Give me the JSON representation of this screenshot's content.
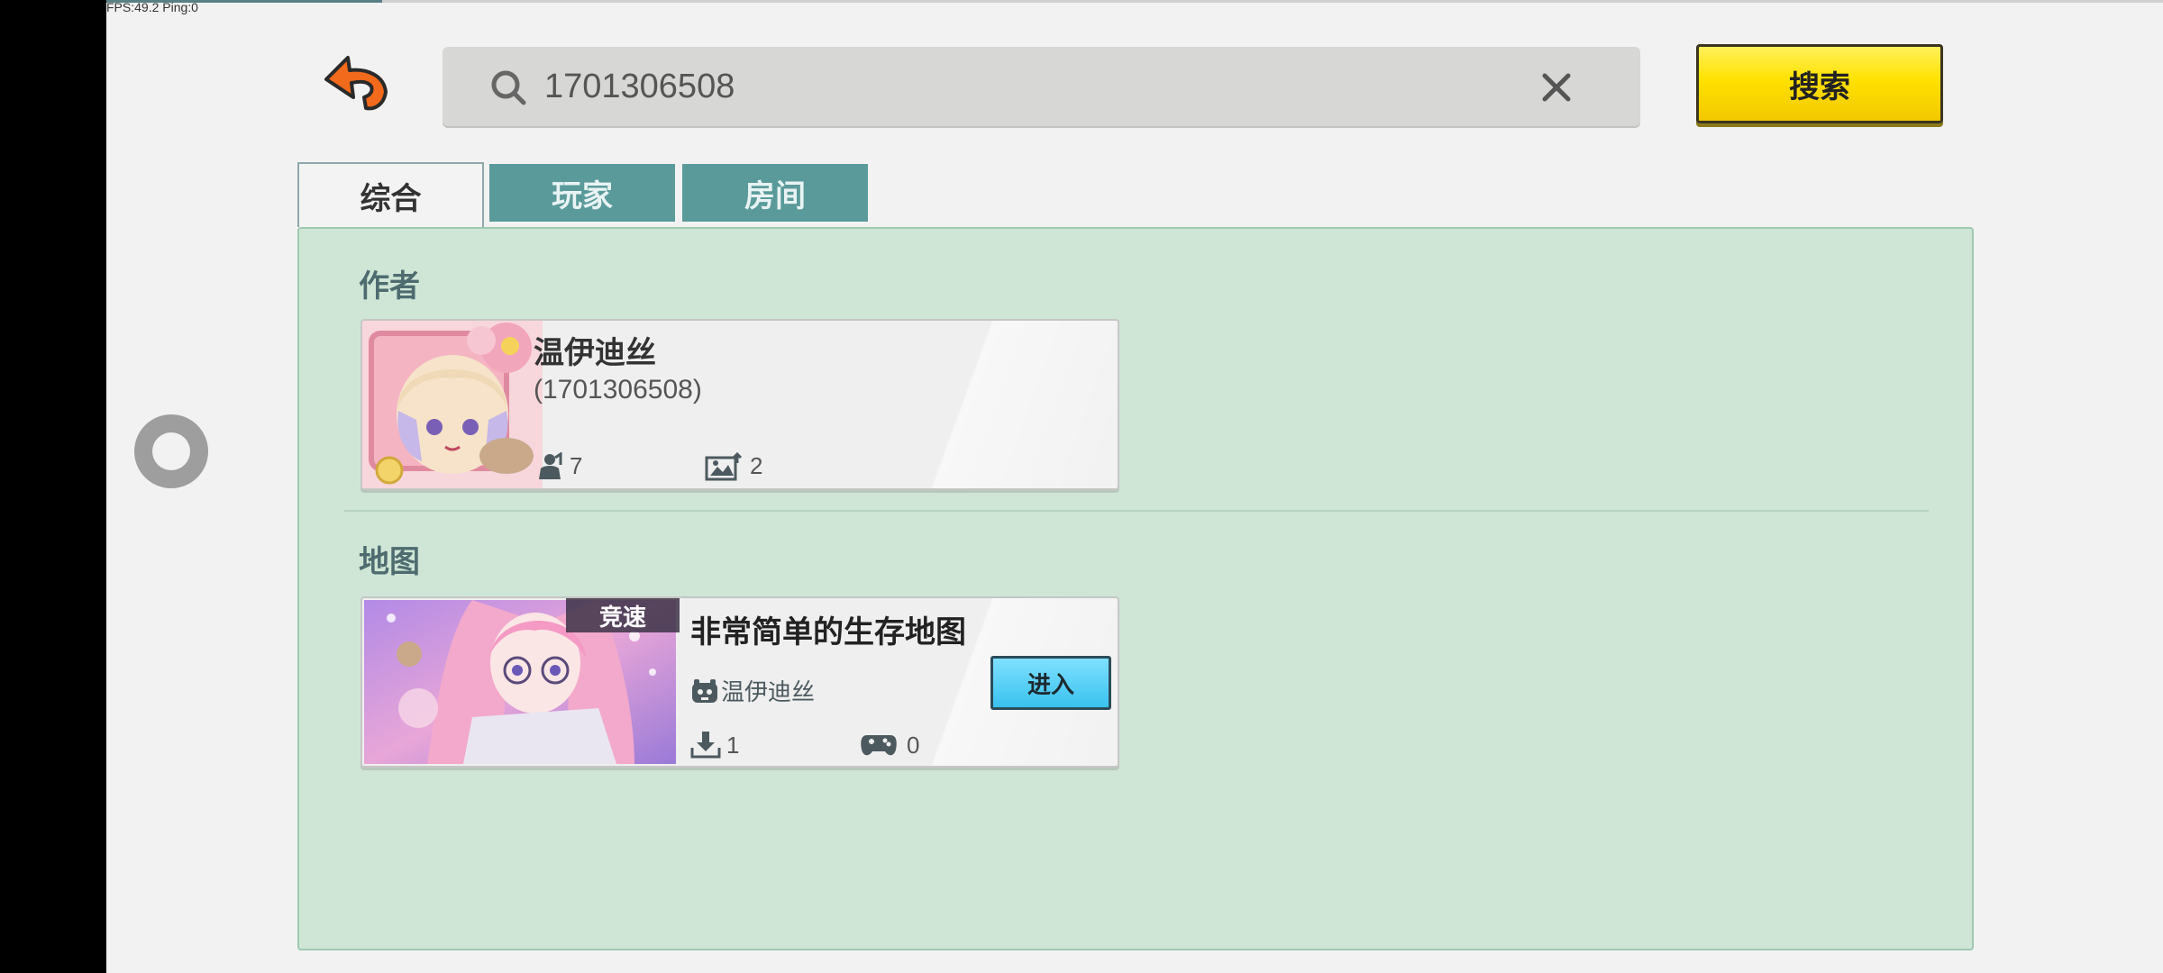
{
  "status": {
    "fps_text": "FPS:49.2 Ping:0"
  },
  "search": {
    "query": "1701306508",
    "button_label": "搜索"
  },
  "tabs": [
    {
      "label": "综合",
      "active": true
    },
    {
      "label": "玩家",
      "active": false
    },
    {
      "label": "房间",
      "active": false
    }
  ],
  "authors": {
    "section_title": "作者",
    "card": {
      "name": "温伊迪丝",
      "id_text": "(1701306508)",
      "fans_count": "7",
      "maps_count": "2"
    }
  },
  "maps": {
    "section_title": "地图",
    "card": {
      "badge": "竞速",
      "title": "非常简单的生存地图",
      "author": "温伊迪丝",
      "enter_label": "进入",
      "downloads": "1",
      "players": "0"
    }
  },
  "colors": {
    "accent_yellow": "#ffe100",
    "tab_teal": "#5a9a9a",
    "panel_green": "#cfe6d6",
    "enter_blue": "#39c2ee",
    "back_orange": "#f26a1b"
  }
}
